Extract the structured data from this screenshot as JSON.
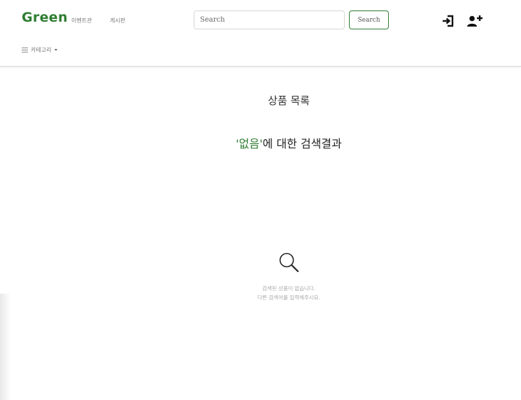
{
  "header": {
    "brand": "Green",
    "nav": [
      {
        "label": "이벤트관"
      },
      {
        "label": "게시판"
      }
    ],
    "search": {
      "placeholder": "Search",
      "button_label": "Search"
    },
    "icons": {
      "login": "login-icon",
      "signup": "add-user-icon"
    },
    "category": {
      "label": "카테고리"
    }
  },
  "main": {
    "title": "상품 목록",
    "result": {
      "quote_open": "'",
      "keyword": "없음",
      "quote_close": "'",
      "suffix": "에 대한 검색결과"
    },
    "empty": {
      "icon": "search-icon",
      "line1": "검색된 상품이 없습니다.",
      "line2": "다른 검색어를 입력해주시요."
    }
  },
  "colors": {
    "brand": "#2e7d32",
    "muted": "#aaaaaa"
  }
}
